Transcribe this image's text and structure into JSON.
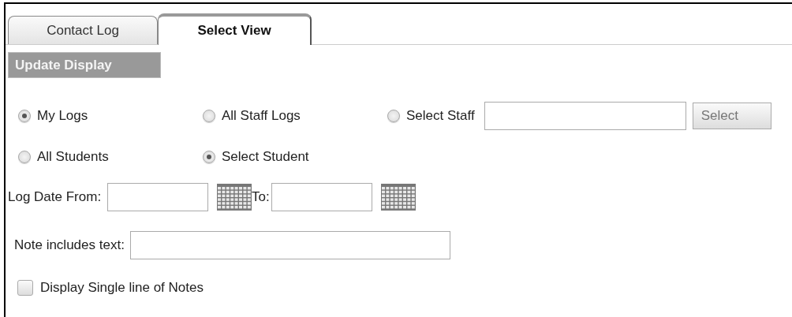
{
  "tabs": [
    {
      "label": "Contact Log",
      "selected": false
    },
    {
      "label": "Select View",
      "selected": true
    }
  ],
  "update_button": "Update Display",
  "staff_options": [
    {
      "label": "My Logs",
      "selected": true
    },
    {
      "label": "All Staff Logs",
      "selected": false
    },
    {
      "label": "Select Staff",
      "selected": false
    }
  ],
  "select_button": "Select",
  "student_options": [
    {
      "label": "All Students",
      "selected": false
    },
    {
      "label": "Select Student",
      "selected": true
    }
  ],
  "date_from_label": "Log Date From:",
  "date_to_label": "To:",
  "note_label": "Note includes text:",
  "single_line": {
    "label": "Display Single line of Notes",
    "checked": false
  }
}
